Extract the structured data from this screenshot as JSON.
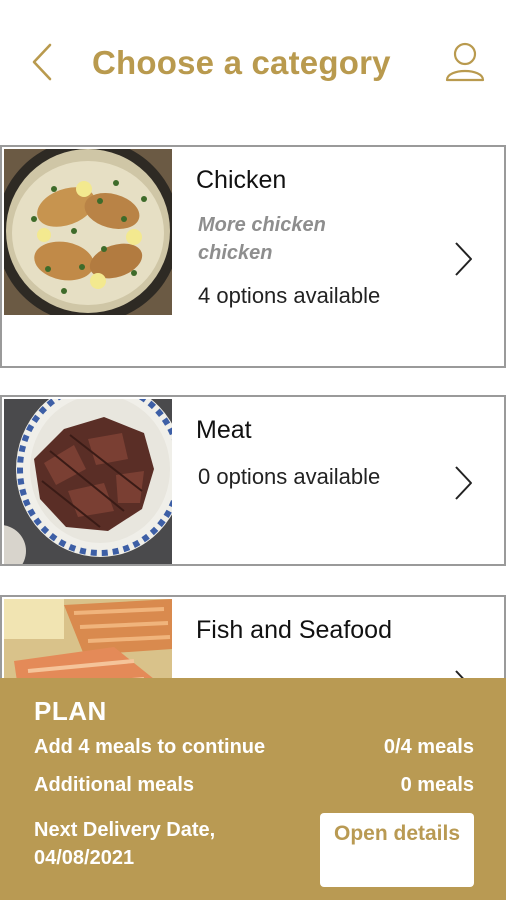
{
  "header": {
    "title": "Choose a category",
    "back_icon": "chevron-left-icon",
    "profile_icon": "user-icon"
  },
  "categories": [
    {
      "name": "Chicken",
      "description": "More chicken chicken",
      "count": "4 options available",
      "image": "creamy chicken dish photo"
    },
    {
      "name": "Meat",
      "description": "",
      "count": "0 options available",
      "image": "sliced beef on plate photo"
    },
    {
      "name": "Fish and Seafood",
      "description": "",
      "count": "",
      "image": "salmon fillet photo"
    }
  ],
  "plan": {
    "title": "PLAN",
    "meals_label": "Add 4 meals to continue",
    "meals_value": "0/4 meals",
    "additional_label": "Additional meals",
    "additional_value": "0 meals",
    "delivery_label": "Next Delivery Date, 04/08/2021",
    "open_button": "Open details"
  },
  "colors": {
    "accent": "#b99a53",
    "title": "#b99a4e",
    "card_border": "#9a9a9a"
  }
}
